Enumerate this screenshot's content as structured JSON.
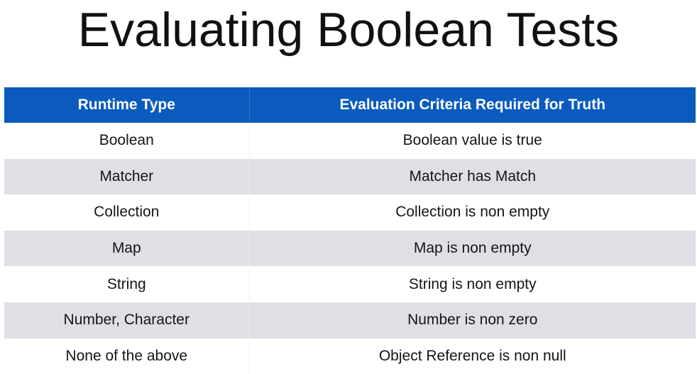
{
  "title": "Evaluating Boolean Tests",
  "table": {
    "headers": [
      "Runtime Type",
      "Evaluation Criteria Required for Truth"
    ],
    "rows": [
      [
        "Boolean",
        "Boolean value is true"
      ],
      [
        "Matcher",
        "Matcher has Match"
      ],
      [
        "Collection",
        "Collection is non empty"
      ],
      [
        "Map",
        "Map is non empty"
      ],
      [
        "String",
        "String is non empty"
      ],
      [
        "Number, Character",
        "Number is non zero"
      ],
      [
        "None of the above",
        "Object Reference is non null"
      ]
    ]
  },
  "colors": {
    "header": "#0a5bbd",
    "stripe": "#dfe0e6"
  }
}
